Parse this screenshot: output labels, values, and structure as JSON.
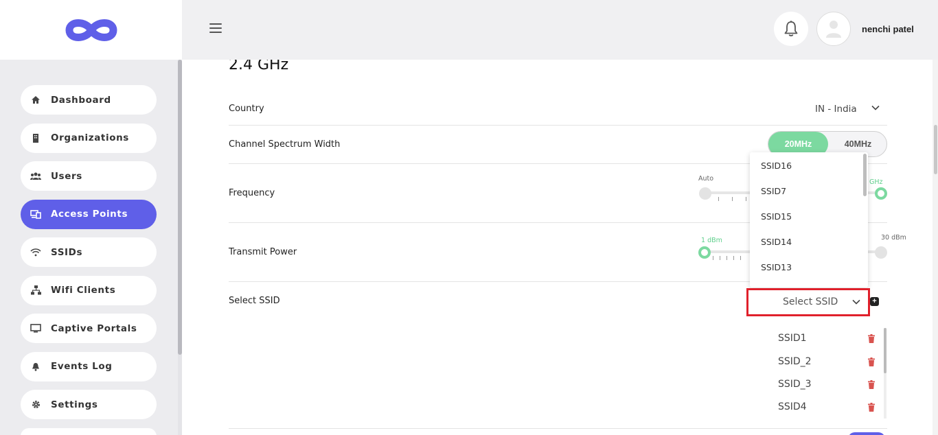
{
  "app": {
    "name": "Dashboard"
  },
  "sidebar": {
    "items": [
      {
        "label": "Dashboard",
        "icon": "home-icon"
      },
      {
        "label": "Organizations",
        "icon": "building-icon"
      },
      {
        "label": "Users",
        "icon": "users-icon"
      },
      {
        "label": "Access Points",
        "icon": "access-point-icon",
        "active": true
      },
      {
        "label": "SSIDs",
        "icon": "wifi-icon"
      },
      {
        "label": "Wifi Clients",
        "icon": "network-icon"
      },
      {
        "label": "Captive Portals",
        "icon": "monitor-icon"
      },
      {
        "label": "Events Log",
        "icon": "bell-icon"
      },
      {
        "label": "Settings",
        "icon": "gear-icon"
      }
    ]
  },
  "header": {
    "username": "nenchi patel"
  },
  "section": {
    "title": "2.4 GHz",
    "country": {
      "label": "Country",
      "value": "IN - India"
    },
    "channel_width": {
      "label": "Channel Spectrum Width",
      "options": [
        "20MHz",
        "40MHz"
      ],
      "selected": "20MHz"
    },
    "frequency": {
      "label": "Frequency",
      "min_label": "Auto",
      "max_label": "GHz"
    },
    "transmit_power": {
      "label": "Transmit Power",
      "current_label": "1 dBm",
      "max_label": "30 dBm"
    },
    "select_ssid": {
      "label": "Select SSID",
      "placeholder": "Select SSID",
      "dropdown_options": [
        "SSID16",
        "SSID7",
        "SSID15",
        "SSID14",
        "SSID13"
      ],
      "selected": [
        "SSID1",
        "SSID_2",
        "SSID_3",
        "SSID4"
      ]
    }
  },
  "colors": {
    "accent": "#5f5fe8",
    "green": "#7cd9a0",
    "highlight": "#e0202b",
    "delete": "#d9534f"
  }
}
